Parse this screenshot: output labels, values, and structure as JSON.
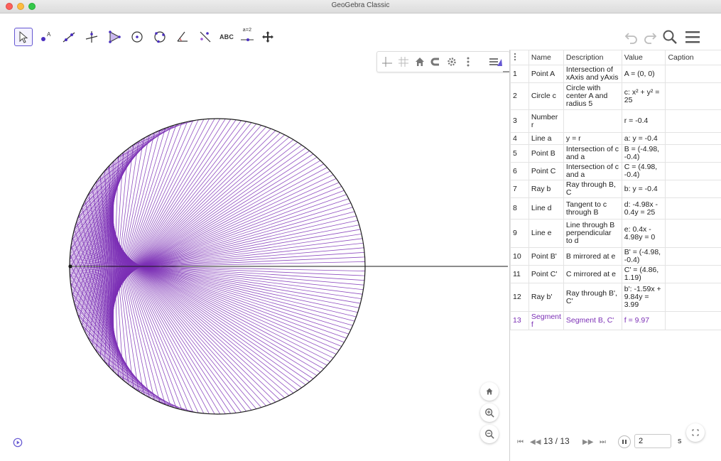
{
  "window": {
    "title": "GeoGebra Classic"
  },
  "toolbar": {
    "tools": [
      {
        "name": "move-tool-icon"
      },
      {
        "name": "point-tool-icon"
      },
      {
        "name": "line-tool-icon"
      },
      {
        "name": "perpendicular-line-tool-icon"
      },
      {
        "name": "polygon-tool-icon"
      },
      {
        "name": "circle-center-point-tool-icon"
      },
      {
        "name": "circle-three-points-tool-icon"
      },
      {
        "name": "angle-tool-icon"
      },
      {
        "name": "reflect-about-line-tool-icon"
      },
      {
        "name": "text-tool-icon"
      },
      {
        "name": "slider-tool-icon"
      },
      {
        "name": "move-graphics-view-tool-icon"
      }
    ],
    "text_tool_label": "ABC",
    "slider_tool_label": "a=2"
  },
  "algebra": {
    "columns": [
      "",
      "Name",
      "Description",
      "Value",
      "Caption"
    ],
    "rows": [
      {
        "n": "1",
        "name": "Point A",
        "desc": "Intersection of xAxis and yAxis",
        "value": "A = (0, 0)",
        "caption": ""
      },
      {
        "n": "2",
        "name": "Circle c",
        "desc": "Circle with center A and radius 5",
        "value": "c: x² + y² = 25",
        "caption": ""
      },
      {
        "n": "3",
        "name": "Number r",
        "desc": "",
        "value": "r = -0.4",
        "caption": ""
      },
      {
        "n": "4",
        "name": "Line a",
        "desc": "y = r",
        "value": "a: y = -0.4",
        "caption": ""
      },
      {
        "n": "5",
        "name": "Point B",
        "desc": "Intersection of c and a",
        "value": "B = (-4.98, -0.4)",
        "caption": ""
      },
      {
        "n": "6",
        "name": "Point C",
        "desc": "Intersection of c and a",
        "value": "C = (4.98, -0.4)",
        "caption": ""
      },
      {
        "n": "7",
        "name": "Ray b",
        "desc": "Ray through B, C",
        "value": "b: y = -0.4",
        "caption": ""
      },
      {
        "n": "8",
        "name": "Line d",
        "desc": "Tangent to c through B",
        "value": "d: -4.98x - 0.4y = 25",
        "caption": ""
      },
      {
        "n": "9",
        "name": "Line e",
        "desc": "Line through B perpendicular to d",
        "value": "e: 0.4x - 4.98y = 0",
        "caption": ""
      },
      {
        "n": "10",
        "name": "Point B'",
        "desc": "B mirrored at e",
        "value": "B' = (-4.98, -0.4)",
        "caption": ""
      },
      {
        "n": "11",
        "name": "Point C'",
        "desc": "C mirrored at e",
        "value": "C' = (4.86, 1.19)",
        "caption": ""
      },
      {
        "n": "12",
        "name": "Ray b'",
        "desc": "Ray through B', C'",
        "value": "b': -1.59x + 9.84y = 3.99",
        "caption": ""
      },
      {
        "n": "13",
        "name": "Segment f",
        "desc": "Segment B, C'",
        "value": "f = 9.97",
        "caption": ""
      }
    ],
    "highlight_row": 13,
    "footer": {
      "step_text": "13 / 13",
      "speed_value": "2",
      "speed_unit": "s"
    }
  },
  "colors": {
    "accent": "#6557d2",
    "curve": "#7b2fb5",
    "circle": "#1a1a1a"
  }
}
